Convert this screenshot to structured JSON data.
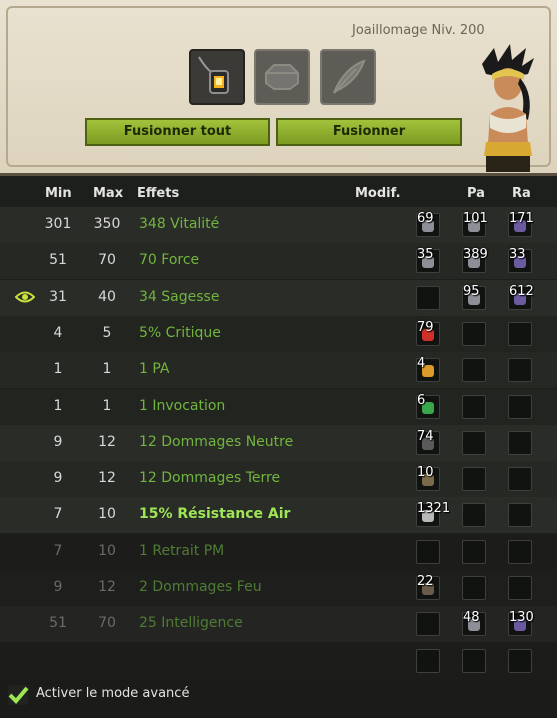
{
  "header": {
    "title": "Joaillomage Niv. 200"
  },
  "buttons": {
    "merge_all": "Fusionner tout",
    "merge": "Fusionner"
  },
  "columns": {
    "min": "Min",
    "max": "Max",
    "effects": "Effets",
    "modif": "Modif.",
    "pa": "Pa",
    "ra": "Ra"
  },
  "rows": [
    {
      "min": "301",
      "max": "350",
      "effect": "348 Vitalité",
      "modif": "69",
      "pa": "101",
      "ra": "171"
    },
    {
      "min": "51",
      "max": "70",
      "effect": "70 Force",
      "modif": "35",
      "pa": "389",
      "ra": "33"
    },
    {
      "min": "31",
      "max": "40",
      "effect": "34 Sagesse",
      "modif": "",
      "pa": "95",
      "ra": "612"
    },
    {
      "min": "4",
      "max": "5",
      "effect": "5% Critique",
      "modif": "79",
      "pa": "",
      "ra": ""
    },
    {
      "min": "1",
      "max": "1",
      "effect": "1 PA",
      "modif": "4",
      "pa": "",
      "ra": ""
    },
    {
      "min": "1",
      "max": "1",
      "effect": "1 Invocation",
      "modif": "6",
      "pa": "",
      "ra": ""
    },
    {
      "min": "9",
      "max": "12",
      "effect": "12 Dommages Neutre",
      "modif": "74",
      "pa": "",
      "ra": ""
    },
    {
      "min": "9",
      "max": "12",
      "effect": "12 Dommages Terre",
      "modif": "10",
      "pa": "",
      "ra": ""
    },
    {
      "min": "7",
      "max": "10",
      "effect": "15% Résistance Air",
      "modif": "1321",
      "pa": "",
      "ra": ""
    },
    {
      "min": "7",
      "max": "10",
      "effect": "1 Retrait PM",
      "modif": "",
      "pa": "",
      "ra": ""
    },
    {
      "min": "9",
      "max": "12",
      "effect": "2 Dommages Feu",
      "modif": "22",
      "pa": "",
      "ra": ""
    },
    {
      "min": "51",
      "max": "70",
      "effect": "25 Intelligence",
      "modif": "",
      "pa": "48",
      "ra": "130"
    },
    {
      "min": "",
      "max": "",
      "effect": "",
      "modif": "",
      "pa": "",
      "ra": ""
    }
  ],
  "footer": {
    "advanced_mode_label": "Activer le mode avancé",
    "advanced_mode_checked": true
  },
  "icons": {
    "slot_1": "lantern-rune-icon",
    "slot_2": "octagon-stone-icon",
    "slot_3": "feather-icon",
    "row_2_indicator": "eye-icon",
    "footer_check": "checkmark-icon"
  },
  "colors": {
    "effect_green": "#72b53e",
    "button_green": "#8db22e",
    "highlight_green": "#9fe655"
  }
}
